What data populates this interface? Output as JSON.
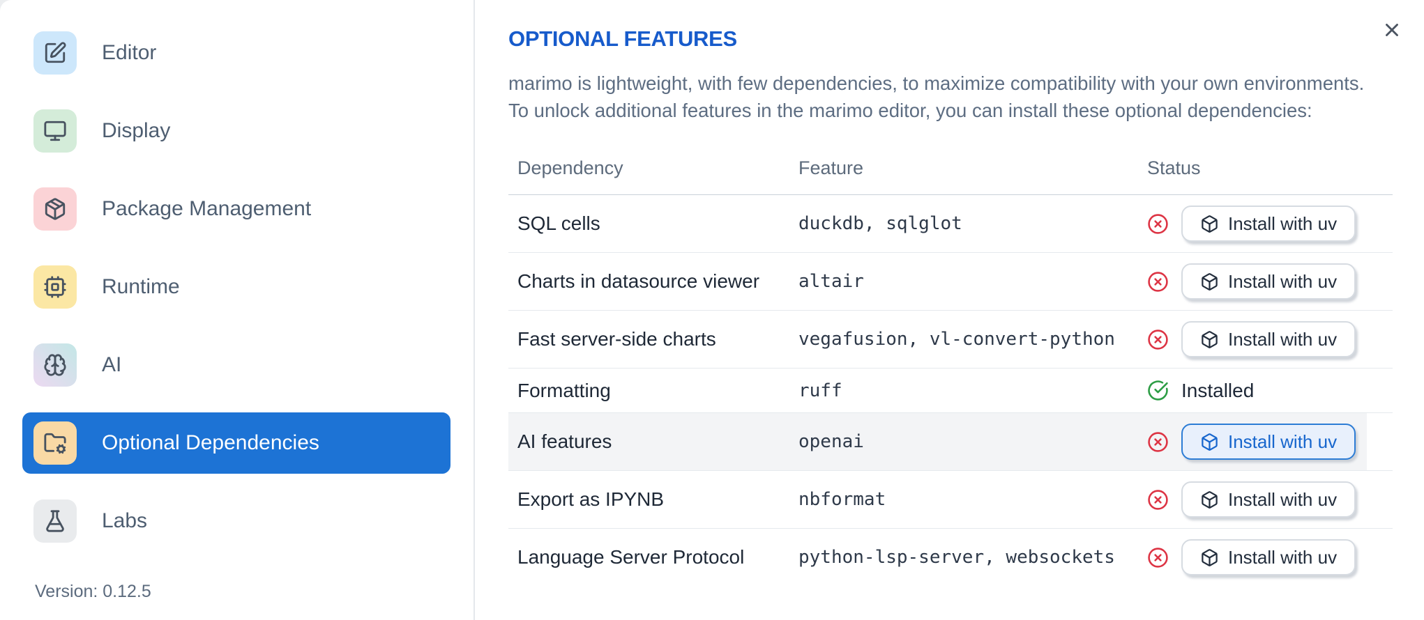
{
  "colors": {
    "accent_blue": "#1d73d5",
    "title_blue": "#175bcb",
    "status_red": "#dd3444",
    "status_green": "#2d9d45",
    "row_highlight": "#f3f4f6"
  },
  "icons": {
    "close": "x",
    "status_missing": "circle-x",
    "status_installed": "circle-check",
    "install_button": "box"
  },
  "sidebar": {
    "items": [
      {
        "label": "Editor",
        "icon": "square-pen",
        "icon_bg": "#cde7fb",
        "selected": false
      },
      {
        "label": "Display",
        "icon": "monitor",
        "icon_bg": "#d4ecd9",
        "selected": false
      },
      {
        "label": "Package Management",
        "icon": "package",
        "icon_bg": "#fbd3d6",
        "selected": false
      },
      {
        "label": "Runtime",
        "icon": "cpu",
        "icon_bg": "#fbe7a4",
        "selected": false
      },
      {
        "label": "AI",
        "icon": "brain",
        "icon_bg_gradient": [
          "#ecd9f1",
          "#c3e7e6"
        ],
        "selected": false
      },
      {
        "label": "Optional Dependencies",
        "icon": "folder-cog",
        "icon_bg": "#f9d9a5",
        "selected": true
      },
      {
        "label": "Labs",
        "icon": "flask",
        "icon_bg": "#e9ebed",
        "selected": false
      }
    ],
    "version": "Version: 0.12.5"
  },
  "main": {
    "title": "OPTIONAL FEATURES",
    "description_line1": "marimo is lightweight, with few dependencies, to maximize compatibility with your own environments.",
    "description_line2": "To unlock additional features in the marimo editor, you can install these optional dependencies:",
    "table": {
      "headers": [
        "Dependency",
        "Feature",
        "Status"
      ],
      "rows": [
        {
          "dependency": "SQL cells",
          "feature": "duckdb, sqlglot",
          "status": "missing",
          "action": "Install with uv",
          "highlighted": false
        },
        {
          "dependency": "Charts in datasource viewer",
          "feature": "altair",
          "status": "missing",
          "action": "Install with uv",
          "highlighted": false
        },
        {
          "dependency": "Fast server-side charts",
          "feature": "vegafusion, vl-convert-python",
          "status": "missing",
          "action": "Install with uv",
          "highlighted": false
        },
        {
          "dependency": "Formatting",
          "feature": "ruff",
          "status": "installed",
          "status_label": "Installed",
          "highlighted": false
        },
        {
          "dependency": "AI features",
          "feature": "openai",
          "status": "missing",
          "action": "Install with uv",
          "highlighted": true
        },
        {
          "dependency": "Export as IPYNB",
          "feature": "nbformat",
          "status": "missing",
          "action": "Install with uv",
          "highlighted": false
        },
        {
          "dependency": "Language Server Protocol",
          "feature": "python-lsp-server, websockets",
          "status": "missing",
          "action": "Install with uv",
          "highlighted": false
        }
      ]
    }
  }
}
